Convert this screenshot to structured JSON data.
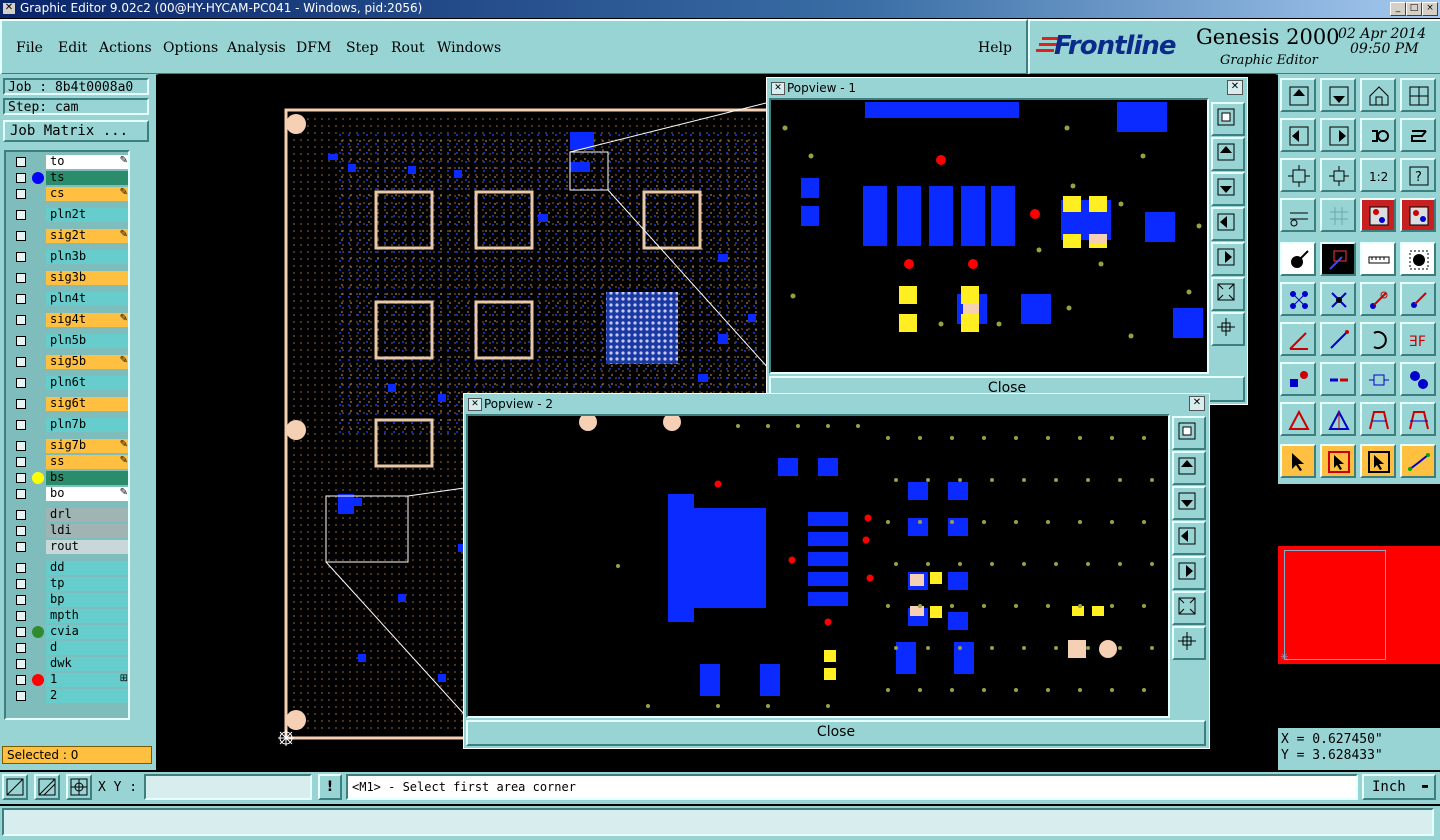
{
  "window": {
    "title": "Graphic Editor 9.02c2 (00@HY-HYCAM-PC041 - Windows, pid:2056)",
    "buttons": [
      "_",
      "□",
      "×"
    ]
  },
  "menu": [
    "File",
    "Edit",
    "Actions",
    "Options",
    "Analysis",
    "DFM",
    "Step",
    "Rout",
    "Windows"
  ],
  "help_label": "Help",
  "brand": {
    "logo": "Frontline",
    "product": "Genesis 2000",
    "subtitle": "Graphic Editor",
    "date": "02 Apr 2014",
    "time": "09:50 PM"
  },
  "job": {
    "job_label": "Job : 8b4t0008a0",
    "step_label": "Step: cam",
    "matrix_button": "Job Matrix ..."
  },
  "layers": [
    {
      "name": "to",
      "color": "#ffffff",
      "dot": "",
      "flag": "✎"
    },
    {
      "name": "ts",
      "color": "#2a8c6a",
      "dot": "#0000ff",
      "flag": ""
    },
    {
      "name": "cs",
      "color": "#ffbf40",
      "dot": "",
      "flag": "✎"
    },
    {
      "name": "pln2t",
      "color": "#66cccc",
      "dot": "",
      "flag": ""
    },
    {
      "name": "sig2t",
      "color": "#ffbf40",
      "dot": "",
      "flag": "✎"
    },
    {
      "name": "pln3b",
      "color": "#66cccc",
      "dot": "",
      "flag": ""
    },
    {
      "name": "sig3b",
      "color": "#ffbf40",
      "dot": "",
      "flag": ""
    },
    {
      "name": "pln4t",
      "color": "#66cccc",
      "dot": "",
      "flag": ""
    },
    {
      "name": "sig4t",
      "color": "#ffbf40",
      "dot": "",
      "flag": "✎"
    },
    {
      "name": "pln5b",
      "color": "#66cccc",
      "dot": "",
      "flag": ""
    },
    {
      "name": "sig5b",
      "color": "#ffbf40",
      "dot": "",
      "flag": "✎"
    },
    {
      "name": "pln6t",
      "color": "#66cccc",
      "dot": "",
      "flag": ""
    },
    {
      "name": "sig6t",
      "color": "#ffbf40",
      "dot": "",
      "flag": ""
    },
    {
      "name": "pln7b",
      "color": "#66cccc",
      "dot": "",
      "flag": ""
    },
    {
      "name": "sig7b",
      "color": "#ffbf40",
      "dot": "",
      "flag": "✎"
    },
    {
      "name": "ss",
      "color": "#ffbf40",
      "dot": "",
      "flag": "✎"
    },
    {
      "name": "bs",
      "color": "#2a8c6a",
      "dot": "#ffff00",
      "flag": ""
    },
    {
      "name": "bo",
      "color": "#ffffff",
      "dot": "",
      "flag": "✎"
    },
    {
      "name": "drl",
      "color": "#a0b4b4",
      "dot": "",
      "flag": ""
    },
    {
      "name": "ldi",
      "color": "#a0b4b4",
      "dot": "",
      "flag": ""
    },
    {
      "name": "rout",
      "color": "#c8d8d8",
      "dot": "",
      "flag": ""
    },
    {
      "name": "dd",
      "color": "#66cccc",
      "dot": "",
      "flag": ""
    },
    {
      "name": "tp",
      "color": "#66cccc",
      "dot": "",
      "flag": ""
    },
    {
      "name": "bp",
      "color": "#66cccc",
      "dot": "",
      "flag": ""
    },
    {
      "name": "mpth",
      "color": "#66cccc",
      "dot": "",
      "flag": ""
    },
    {
      "name": "cvia",
      "color": "#66cccc",
      "dot": "#2e8b2e",
      "flag": ""
    },
    {
      "name": "d",
      "color": "#66cccc",
      "dot": "",
      "flag": ""
    },
    {
      "name": "dwk",
      "color": "#66cccc",
      "dot": "",
      "flag": ""
    },
    {
      "name": "1",
      "color": "#66cccc",
      "dot": "#ff0000",
      "flag": "⊞"
    },
    {
      "name": "2",
      "color": "#66cccc",
      "dot": "",
      "flag": ""
    }
  ],
  "selected_label": "Selected : 0",
  "popview1": {
    "title": "Popview - 1",
    "close": "Close"
  },
  "popview2": {
    "title": "Popview - 2",
    "close": "Close"
  },
  "coords": {
    "x": "X = 0.627450\"",
    "y": "Y = 3.628433\""
  },
  "command": {
    "xy_label": "X Y :",
    "xy_value": "",
    "prompt": "<M1> - Select first area corner",
    "units": "Inch"
  },
  "colors": {
    "panel": "#99d4d4",
    "copper_blue": "#0a2aff",
    "pad_yellow": "#ffee22",
    "via_red": "#ff0000",
    "pad_peach": "#f5d0b5"
  }
}
